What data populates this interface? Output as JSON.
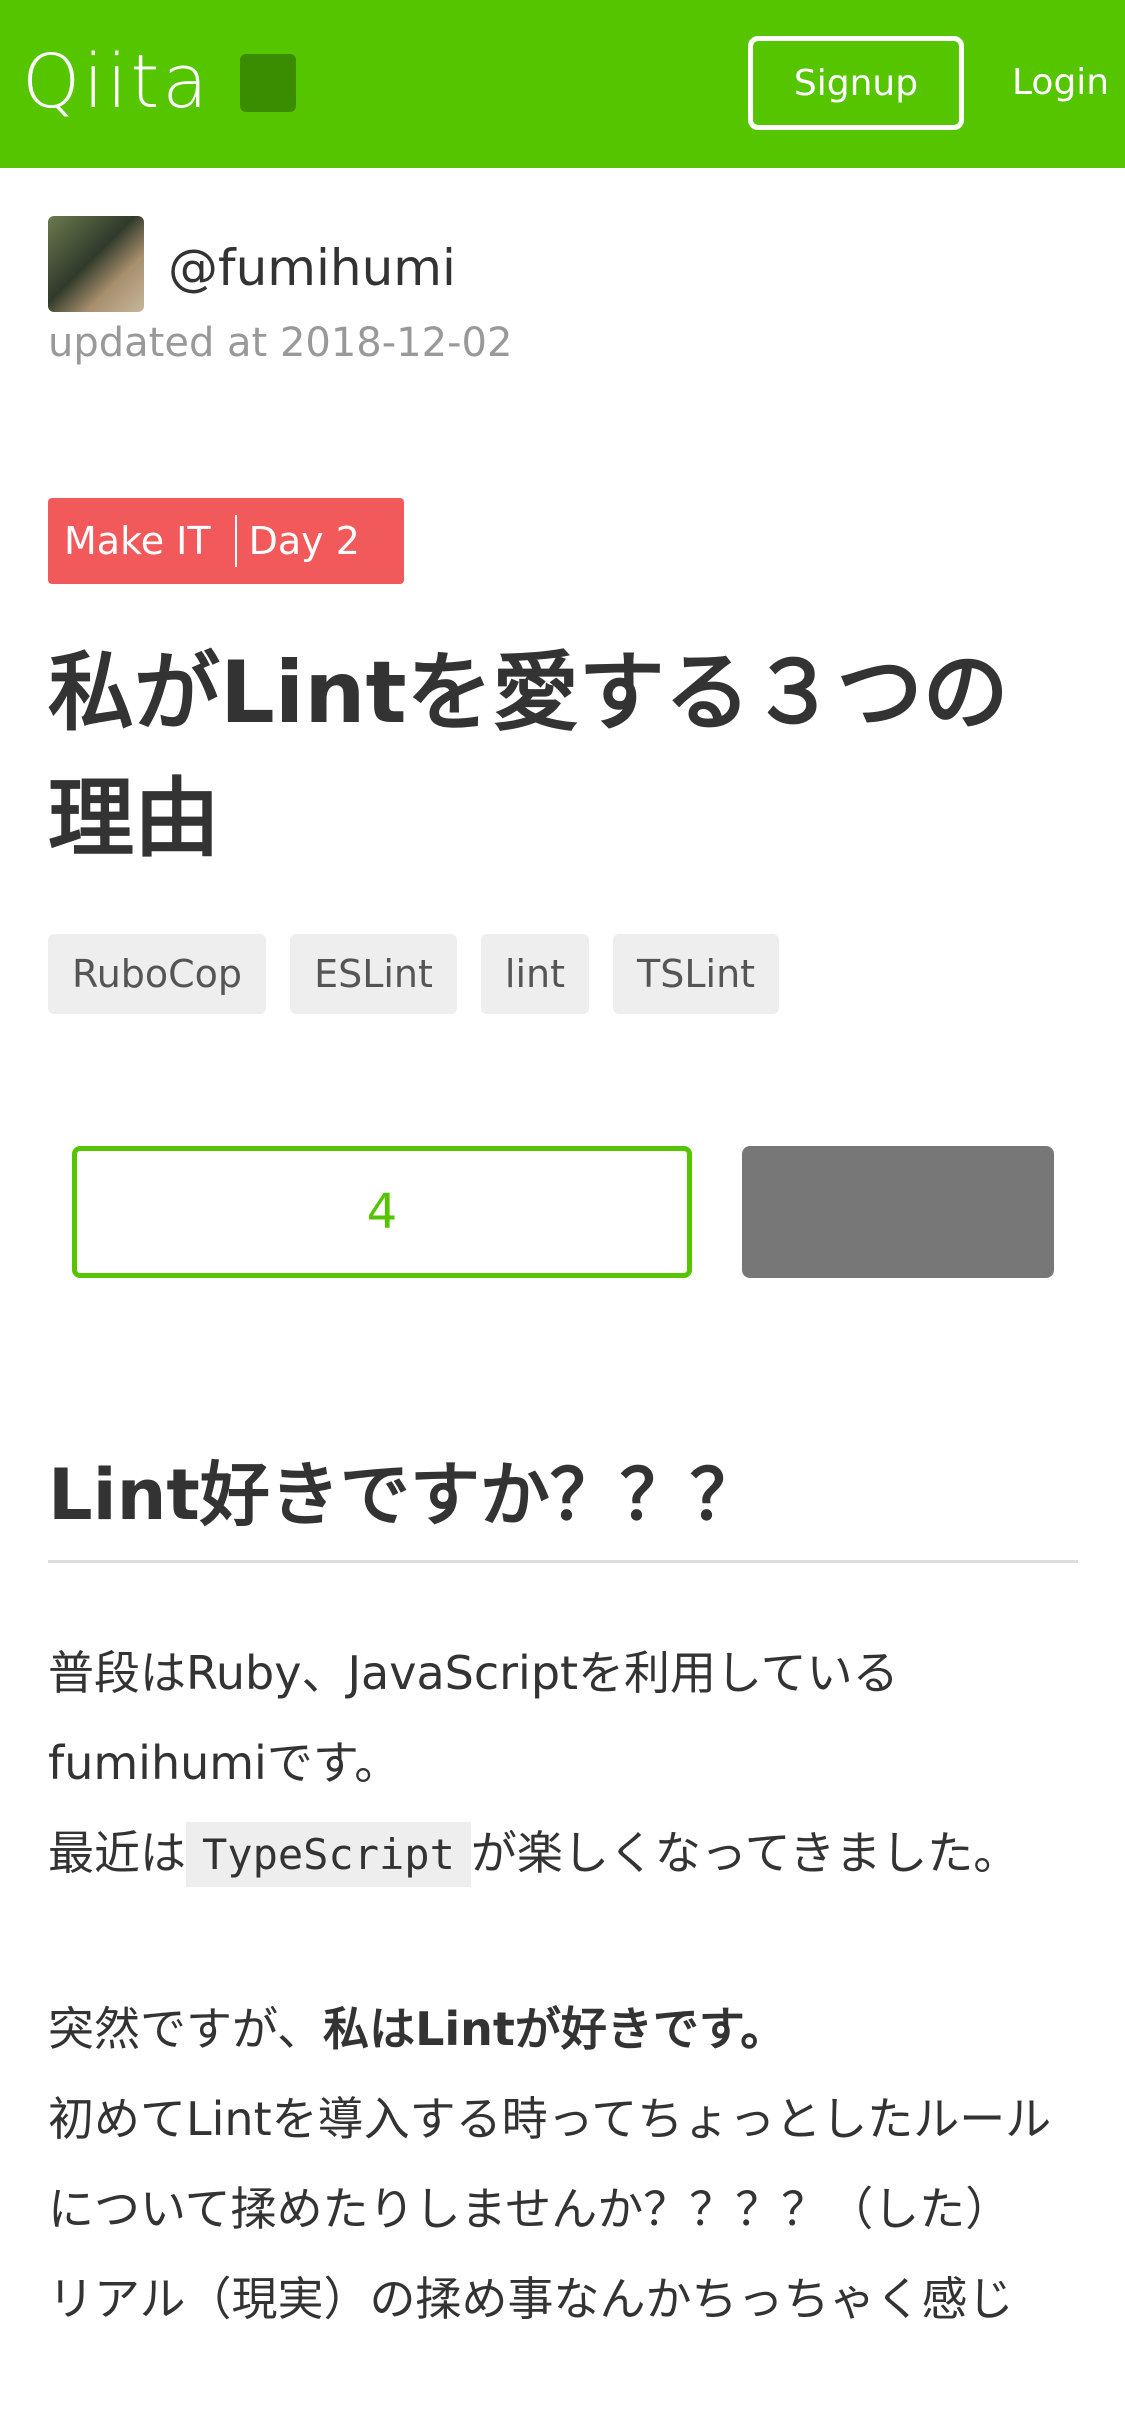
{
  "header": {
    "logo": "Qiita",
    "signup_label": "Signup",
    "login_label": "Login"
  },
  "author": {
    "name": "@fumihumi",
    "updated": "updated at 2018-12-02"
  },
  "advent": {
    "calendar": "Make IT",
    "day": "Day 2"
  },
  "article": {
    "title": "私がLintを愛する３つの理由",
    "tags": [
      "RuboCop",
      "ESLint",
      "lint",
      "TSLint"
    ],
    "likes": "4",
    "heading": "Lint好きですか？？？",
    "p1_line1": "普段はRuby、JavaScriptを利用しているfumihumiです。",
    "p1_line2_before": "最近は",
    "p1_code": "TypeScript",
    "p1_line2_after": "が楽しくなってきました。",
    "p2_before": "突然ですが、",
    "p2_strong": "私はLintが好きです。",
    "p2_line2": "初めてLintを導入する時ってちょっとしたルールについて揉めたりしませんか？？？？（した）",
    "p2_line3": "リアル（現実）の揉め事なんかちっちゃく感じ"
  },
  "colors": {
    "brand": "#55c500",
    "advent": "#f2595a",
    "stock": "#777777"
  }
}
